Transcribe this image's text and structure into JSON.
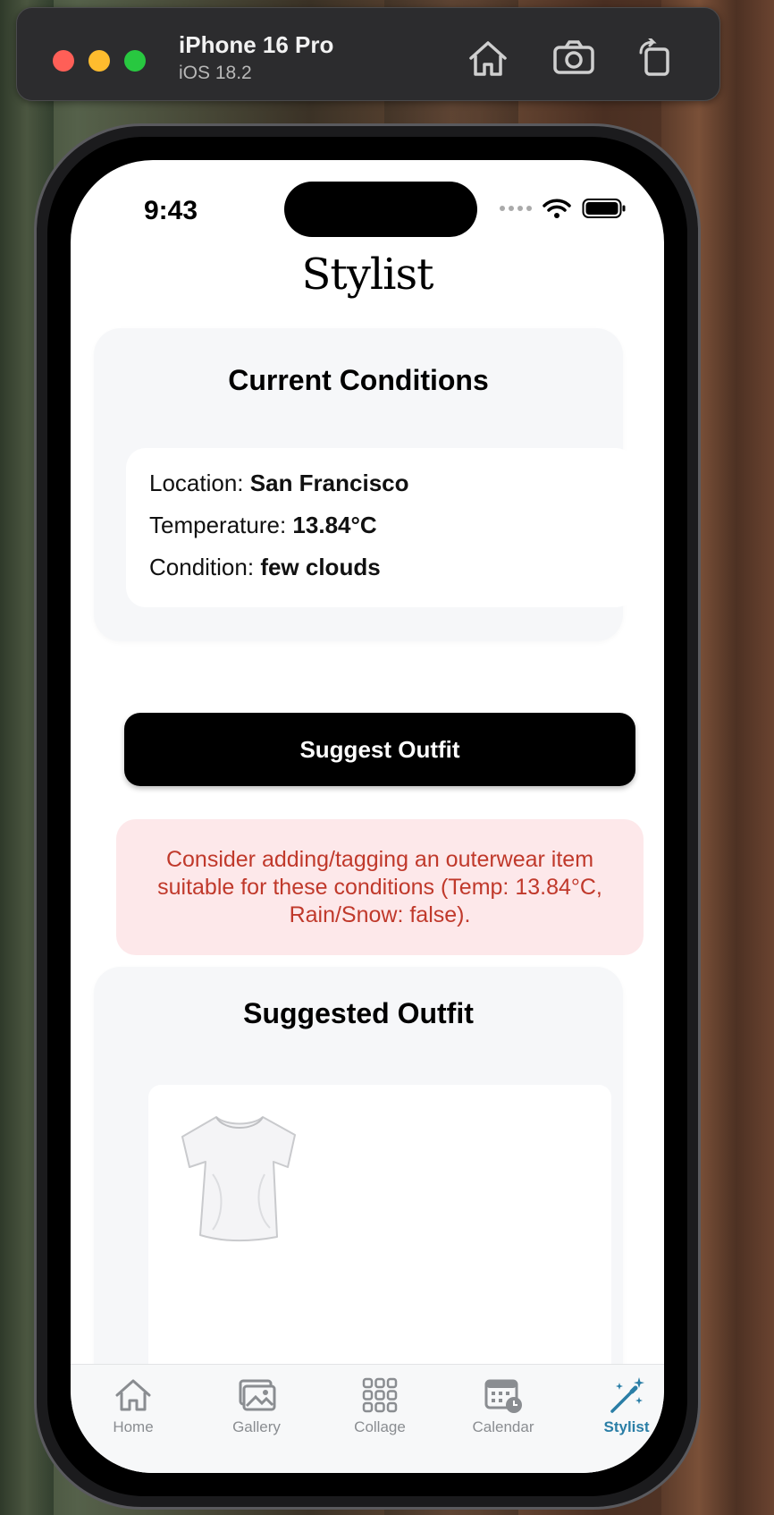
{
  "simulator": {
    "device_name": "iPhone 16 Pro",
    "os_version": "iOS 18.2",
    "buttons": {
      "home": "home-icon",
      "screenshot": "camera-icon",
      "rotate": "rotate-icon"
    }
  },
  "status_bar": {
    "time": "9:43",
    "icons": [
      "signal-dots-icon",
      "wifi-icon",
      "battery-icon"
    ]
  },
  "app": {
    "title": "Stylist"
  },
  "conditions": {
    "heading": "Current Conditions",
    "location_label": "Location:",
    "location_value": "San Francisco",
    "temperature_label": "Temperature:",
    "temperature_value": "13.84°C",
    "condition_label": "Condition:",
    "condition_value": "few clouds"
  },
  "suggest_button": {
    "label": "Suggest Outfit"
  },
  "warning": {
    "text": "Consider adding/tagging an outerwear item suitable for these conditions (Temp: 13.84°C, Rain/Snow: false).",
    "color": "#c0392b",
    "background": "#fde8ea"
  },
  "outfit": {
    "heading": "Suggested Outfit",
    "items": [
      {
        "icon": "tshirt-image"
      }
    ]
  },
  "tabs": [
    {
      "label": "Home",
      "icon": "house-icon",
      "active": false
    },
    {
      "label": "Gallery",
      "icon": "photos-icon",
      "active": false
    },
    {
      "label": "Collage",
      "icon": "grid-icon",
      "active": false
    },
    {
      "label": "Calendar",
      "icon": "calendar-clock-icon",
      "active": false
    },
    {
      "label": "Stylist",
      "icon": "magic-wand-icon",
      "active": true
    }
  ],
  "colors": {
    "accent": "#2a7ea6",
    "button": "#000000",
    "card_bg": "#f6f7f9"
  }
}
